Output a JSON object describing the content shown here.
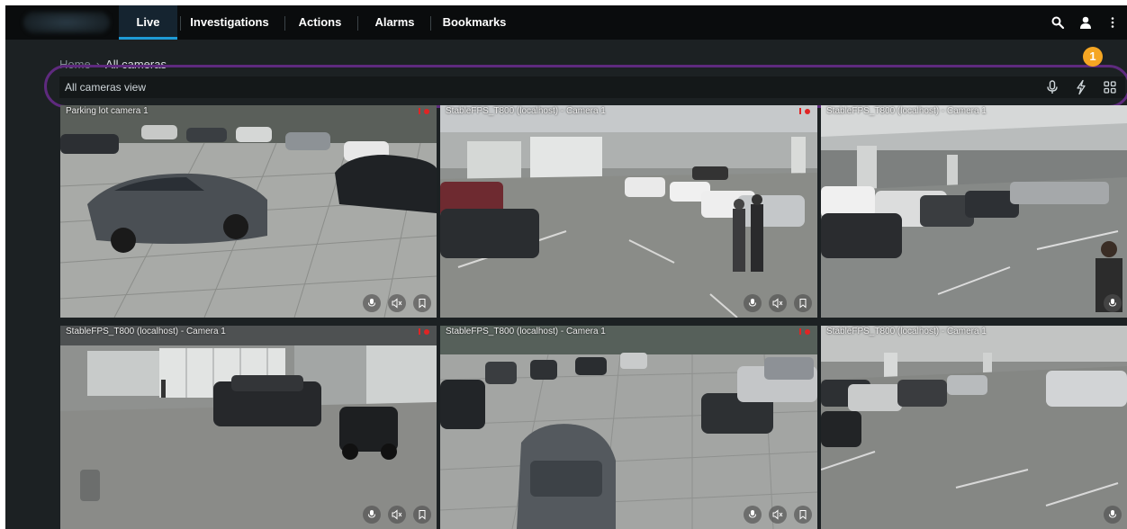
{
  "topbar": {
    "tabs": [
      {
        "label": "Live",
        "active": true
      },
      {
        "label": "Investigations",
        "active": false
      },
      {
        "label": "Actions",
        "active": false
      },
      {
        "label": "Alarms",
        "active": false
      },
      {
        "label": "Bookmarks",
        "active": false
      }
    ],
    "icons": [
      "search-icon",
      "user-icon",
      "more-vertical-icon"
    ]
  },
  "breadcrumb": {
    "home": "Home",
    "current": "All cameras"
  },
  "viewbar": {
    "title": "All cameras view",
    "icons": [
      "microphone-icon",
      "lightning-icon",
      "grid-layout-icon"
    ]
  },
  "callout_badge": "1",
  "cameras": [
    {
      "label": "Parking lot camera 1",
      "recording": true
    },
    {
      "label": "StableFPS_T800 (localhost) - Camera 1",
      "recording": true
    },
    {
      "label": "StableFPS_T800 (localhost) - Camera 1",
      "recording": false
    },
    {
      "label": "StableFPS_T800 (localhost) - Camera 1",
      "recording": true
    },
    {
      "label": "StableFPS_T800 (localhost) - Camera 1",
      "recording": true
    },
    {
      "label": "StableFPS_T800 (localhost) - Camera 1",
      "recording": false
    }
  ],
  "tile_controls": [
    "microphone-icon",
    "speaker-muted-icon",
    "bookmark-icon"
  ],
  "colors": {
    "accent": "#1e9bd7",
    "highlight_ring": "#5e2a7e",
    "badge": "#f5a623",
    "recording": "#e02424",
    "background": "#1c2123",
    "topbar": "#0a0c0d"
  }
}
